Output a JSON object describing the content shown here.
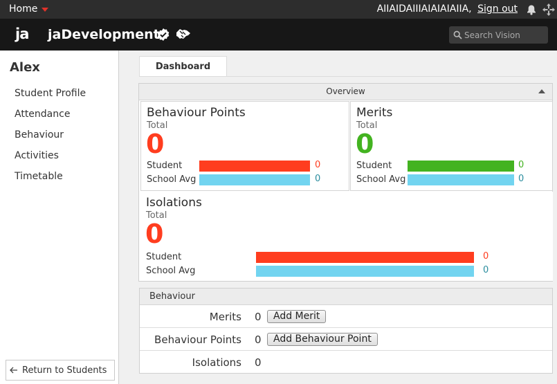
{
  "topbar": {
    "home_label": "Home",
    "user_name": "AIIAIDAIIIAIAIAIAIIA,",
    "signout_label": "Sign out"
  },
  "header": {
    "logo": "ja",
    "app_title": "jaDevelopment",
    "search_placeholder": "Search Vision"
  },
  "sidebar": {
    "student_name": "Alex",
    "items": [
      {
        "label": "Student Profile"
      },
      {
        "label": "Attendance"
      },
      {
        "label": "Behaviour"
      },
      {
        "label": "Activities"
      },
      {
        "label": "Timetable"
      }
    ],
    "return_label": "Return to Students"
  },
  "tabs": [
    {
      "label": "Dashboard"
    }
  ],
  "overview": {
    "title": "Overview",
    "cards": [
      {
        "title": "Behaviour Points",
        "sub": "Total",
        "value": "0",
        "accent": "#ff3d1f",
        "student_label": "Student",
        "student_value": "0",
        "avg_label": "School Avg",
        "avg_value": "0"
      },
      {
        "title": "Merits",
        "sub": "Total",
        "value": "0",
        "accent": "#43b320",
        "student_label": "Student",
        "student_value": "0",
        "avg_label": "School Avg",
        "avg_value": "0"
      },
      {
        "title": "Isolations",
        "sub": "Total",
        "value": "0",
        "accent": "#ff3d1f",
        "student_label": "Student",
        "student_value": "0",
        "avg_label": "School Avg",
        "avg_value": "0"
      }
    ],
    "avg_color": "#72d4f0",
    "avg_value_color": "#2a8d9e"
  },
  "behaviour": {
    "title": "Behaviour",
    "rows": [
      {
        "label": "Merits",
        "value": "0",
        "button": "Add Merit"
      },
      {
        "label": "Behaviour Points",
        "value": "0",
        "button": "Add Behaviour Point"
      },
      {
        "label": "Isolations",
        "value": "0"
      }
    ]
  }
}
